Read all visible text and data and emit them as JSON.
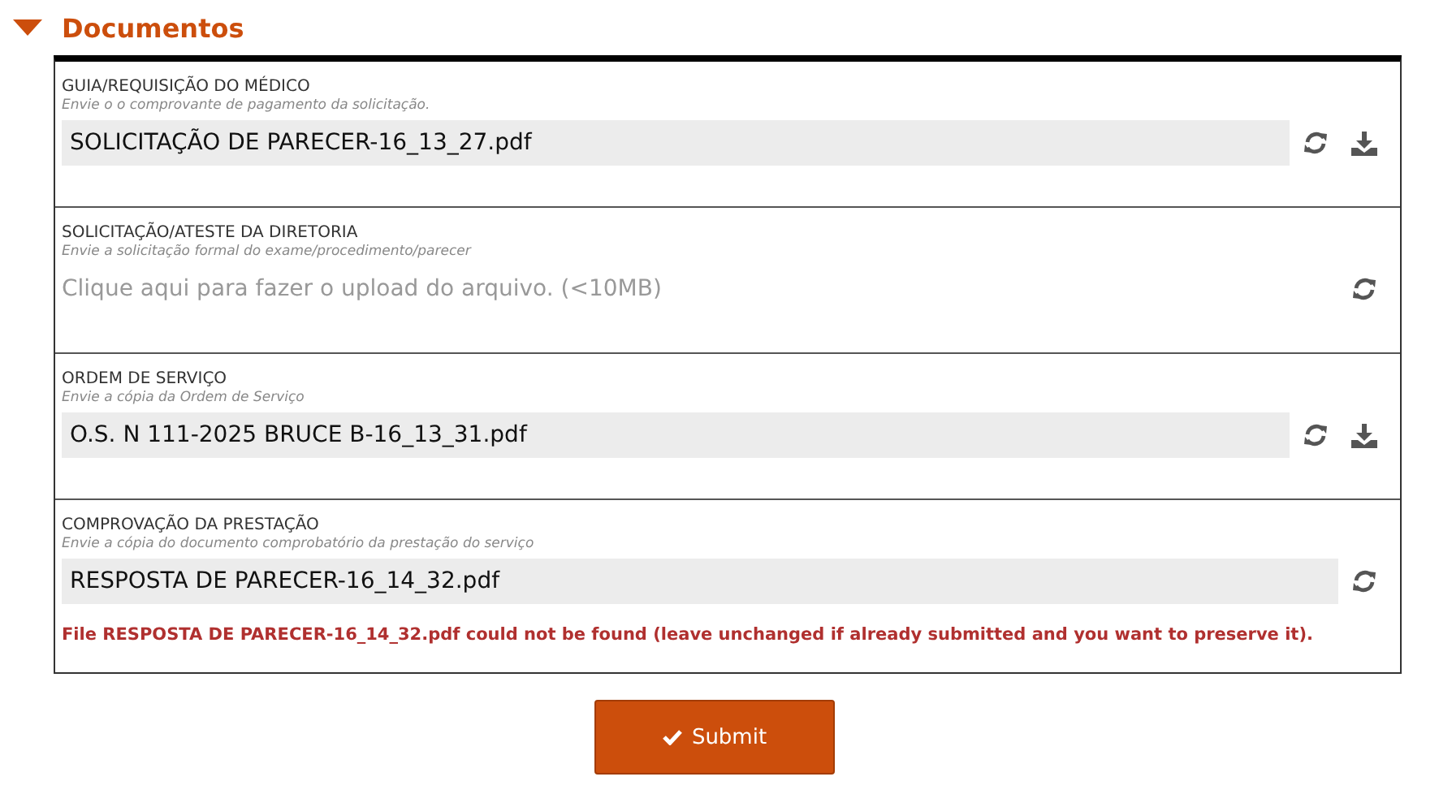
{
  "section": {
    "title": "Documentos",
    "expanded": true
  },
  "documents": [
    {
      "label": "GUIA/REQUISIÇÃO DO MÉDICO",
      "hint": "Envie o o comprovante de pagamento da solicitação.",
      "file": "SOLICITAÇÃO DE PARECER-16_13_27.pdf",
      "downloadable": true
    },
    {
      "label": "SOLICITAÇÃO/ATESTE DA DIRETORIA",
      "hint": "Envie a solicitação formal do exame/procedimento/parecer",
      "placeholder": "Clique aqui para fazer o upload do arquivo. (<10MB)",
      "downloadable": false
    },
    {
      "label": "ORDEM DE SERVIÇO",
      "hint": "Envie a cópia da Ordem de Serviço",
      "file": "O.S. N 111-2025 BRUCE B-16_13_31.pdf",
      "downloadable": true
    },
    {
      "label": "COMPROVAÇÃO DA PRESTAÇÃO",
      "hint": "Envie a cópia do documento comprobatório da prestação do serviço",
      "file": "RESPOSTA DE PARECER-16_14_32.pdf",
      "downloadable": false,
      "error": "File RESPOSTA DE PARECER-16_14_32.pdf could not be found (leave unchanged if already submitted and you want to preserve it)."
    }
  ],
  "submit": {
    "label": "Submit"
  }
}
